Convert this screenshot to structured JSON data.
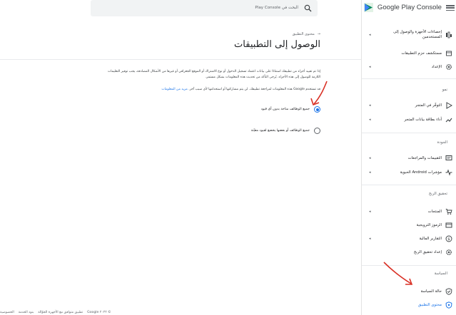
{
  "app": {
    "title": "Google Play Console"
  },
  "search": {
    "placeholder": "البحث في Play Console"
  },
  "sidebar": {
    "items_top": [
      {
        "label": "إحصاءات الأجهزة والوصول إلى المستخدمين",
        "icon": "device-stats-icon",
        "chevron": "◂"
      },
      {
        "label": "مستكشف حزم التطبيقات",
        "icon": "package-icon"
      },
      {
        "label": "الإعداد",
        "icon": "gear-icon",
        "chevron": "◂"
      }
    ],
    "sections": [
      {
        "title": "نمو",
        "items": [
          {
            "label": "التوفّر في المتجر",
            "icon": "play-icon",
            "chevron": "◂"
          },
          {
            "label": "أداء بطاقة بيانات المتجر",
            "icon": "trending-icon",
            "chevron": "◂"
          }
        ]
      },
      {
        "title": "الجودة",
        "items": [
          {
            "label": "التقييمات والمراجعات",
            "icon": "chat-icon",
            "chevron": "◂"
          },
          {
            "label": "مؤشرات Android الحيوية",
            "icon": "vitals-icon",
            "chevron": "◂"
          }
        ]
      },
      {
        "title": "تحقيق الربح",
        "items": [
          {
            "label": "المنتجات",
            "icon": "cart-icon",
            "chevron": "◂"
          },
          {
            "label": "الرموز الترويجية",
            "icon": "promo-icon"
          },
          {
            "label": "التقارير المالية",
            "icon": "dollar-icon",
            "chevron": "◂"
          },
          {
            "label": "إعداد تحقيق الربح",
            "icon": "settings-icon"
          }
        ]
      },
      {
        "title": "السياسة",
        "items": [
          {
            "label": "حالة السياسة",
            "icon": "shield-check-icon"
          },
          {
            "label": "محتوى التطبيق",
            "icon": "shield-icon",
            "active": true
          }
        ]
      }
    ]
  },
  "main": {
    "breadcrumb": "محتوى التطبيق",
    "breadcrumb_arrow": "→",
    "title": "الوصول إلى التطبيقات",
    "description": "إذا تم تقييد أجزاء من تطبيقك استنادًا على بيانات اعتماد تسجيل الدخول أو نوع الاشتراك أو الموقع الجغرافي أو غيرها من الأشكال المصادقة، يجب توفير التعليمات اللازمة للوصول إلى هذه الأجزاء. يُرجى التأكد من تحديث هذه المعلومات بشكل مستمر.",
    "note": "قد تستخدم Google هذه المعلومات لمراجعة تطبيقك. لن يتم مشاركتها أو استخدامها لأي سبب آخر.",
    "learn_more": "مزيد من المعلومات",
    "options": [
      {
        "label": "جميع الوظائف متاحة بدون أي قيود",
        "selected": true
      },
      {
        "label": "جميع الوظائف أو بعضها يخضع لقيود معيّنة",
        "selected": false
      }
    ]
  },
  "footer": {
    "items": [
      "© ٢٠٢٢ Google",
      "تطبيق متوافق مع الأجهزة الجوّالة",
      "بنود الخدمة",
      "الخصوصية"
    ]
  },
  "colors": {
    "accent": "#1a73e8",
    "annotation": "#d93025"
  }
}
